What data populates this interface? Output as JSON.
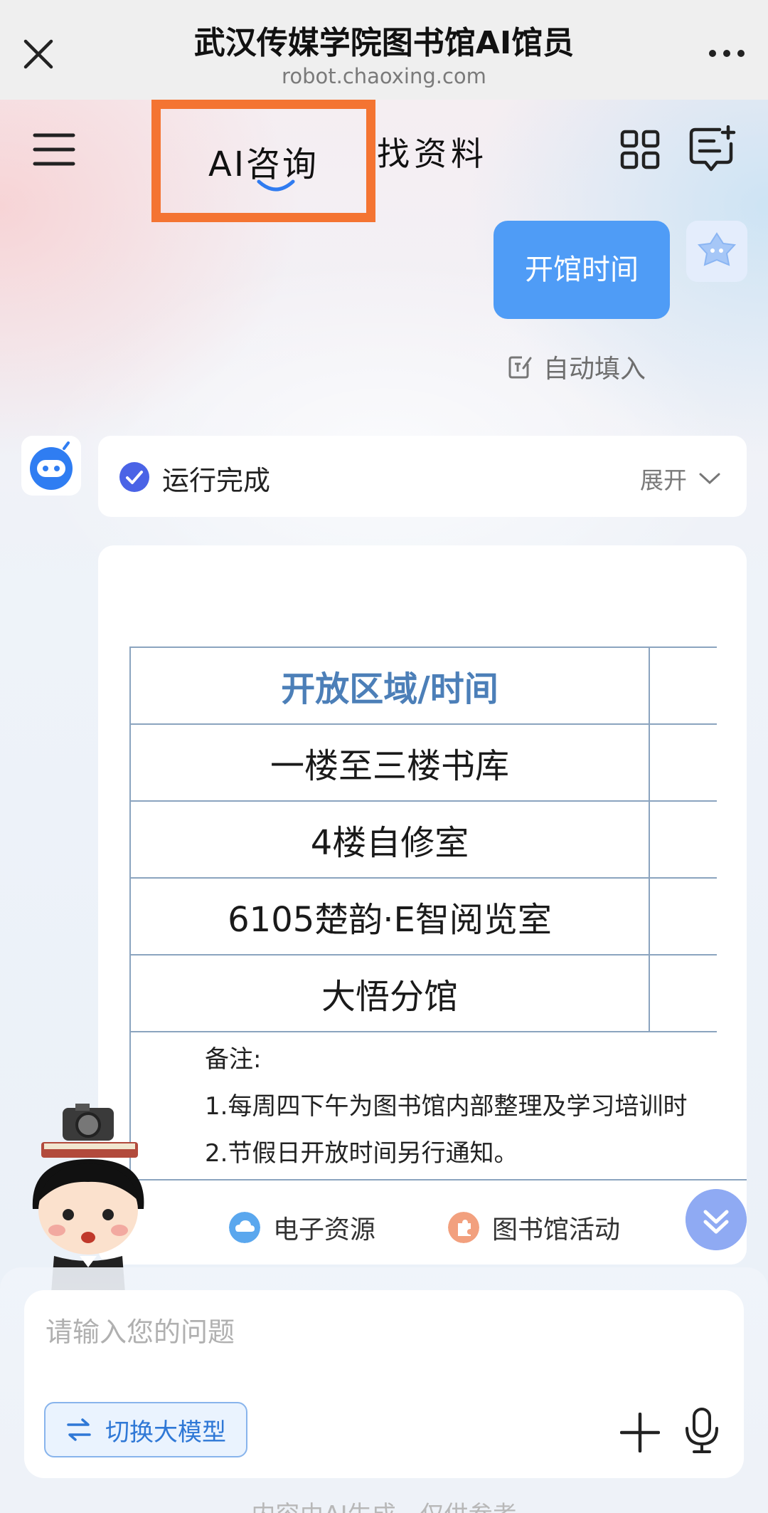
{
  "browser": {
    "title": "武汉传媒学院图书馆AI馆员",
    "url": "robot.chaoxing.com"
  },
  "header": {
    "tabs": [
      {
        "label": "AI咨询",
        "active": true
      },
      {
        "label": "找资料",
        "active": false
      }
    ],
    "highlight_color": "#f47432"
  },
  "chat": {
    "user_message": "开馆时间",
    "autofill_label": "自动填入",
    "status": {
      "text": "运行完成",
      "expand_label": "展开"
    },
    "table": {
      "header": "开放区域/时间",
      "rows": [
        "一楼至三楼书库",
        "4楼自修室",
        "6105楚韵·E智阅览室",
        "大悟分馆"
      ]
    },
    "notes": {
      "title": "备注:",
      "lines": [
        "1.每周四下午为图书馆内部整理及学习培训时",
        "2.节假日开放时间另行通知。"
      ]
    },
    "suggestions": [
      "电子资源",
      "图书馆活动"
    ]
  },
  "input": {
    "placeholder": "请输入您的问题",
    "switch_model_label": "切换大模型"
  },
  "disclaimer": "内容由AI生成，仅供参考",
  "colors": {
    "accent_blue": "#4f9cf6",
    "table_header": "#4c7fb8",
    "table_border": "#8ba4bf"
  }
}
